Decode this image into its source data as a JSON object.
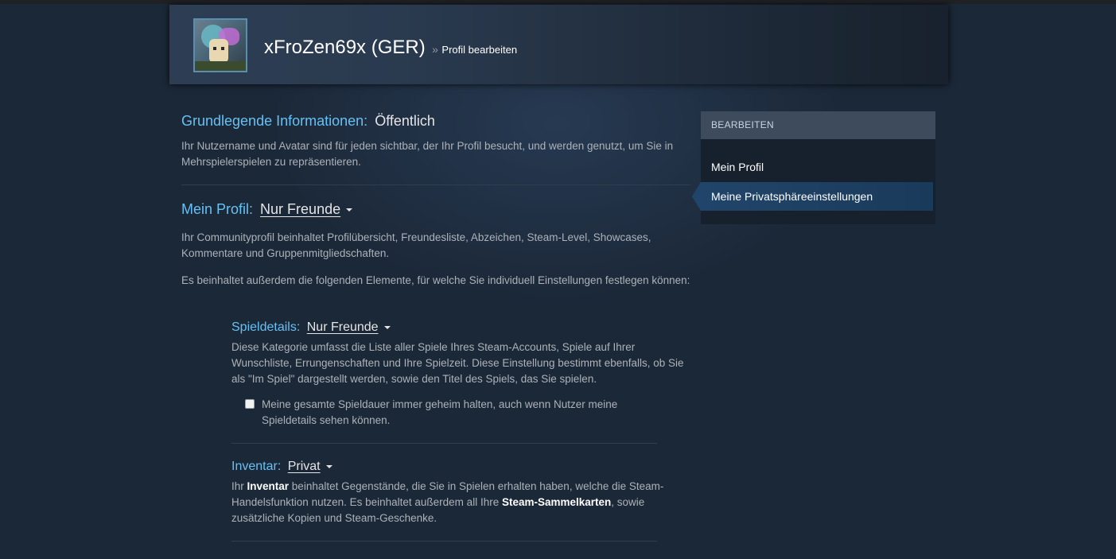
{
  "header": {
    "persona_name": "xFroZen69x (GER)",
    "separator": "»",
    "subpage": "Profil bearbeiten"
  },
  "basic_info": {
    "title": "Grundlegende Informationen:",
    "value": "Öffentlich",
    "description": "Ihr Nutzername und Avatar sind für jeden sichtbar, der Ihr Profil besucht, und werden genutzt, um Sie in Mehrspielerspielen zu repräsentieren."
  },
  "my_profile": {
    "title": "Mein Profil:",
    "setting": "Nur Freunde",
    "description": "Ihr Communityprofil beinhaltet Profilübersicht, Freundesliste, Abzeichen, Steam-Level, Showcases, Kommentare und Gruppenmitgliedschaften.",
    "description2": "Es beinhaltet außerdem die folgenden Elemente, für welche Sie individuell Einstellungen festlegen können:"
  },
  "game_details": {
    "title": "Spieldetails:",
    "setting": "Nur Freunde",
    "description": "Diese Kategorie umfasst die Liste aller Spiele Ihres Steam-Accounts, Spiele auf Ihrer Wunschliste, Errungenschaften und Ihre Spielzeit. Diese Einstellung bestimmt ebenfalls, ob Sie als \"Im Spiel\" dargestellt werden, sowie den Titel des Spiels, das Sie spielen.",
    "checkbox_label": "Meine gesamte Spieldauer immer geheim halten, auch wenn Nutzer meine Spieldetails sehen können.",
    "checkbox_checked": false
  },
  "inventory": {
    "title": "Inventar:",
    "setting": "Privat",
    "desc_part1": "Ihr ",
    "desc_bold1": "Inventar",
    "desc_part2": " beinhaltet Gegenstände, die Sie in Spielen erhalten haben, welche die Steam-Handelsfunktion nutzen. Es beinhaltet außerdem all Ihre ",
    "desc_bold2": "Steam-Sammelkarten",
    "desc_part3": ", sowie zusätzliche Kopien und Steam-Geschenke."
  },
  "sidebar": {
    "heading": "BEARBEITEN",
    "items": [
      {
        "label": "Mein Profil",
        "active": false
      },
      {
        "label": "Meine Privatsphäreeinstellungen",
        "active": true
      }
    ]
  },
  "colors": {
    "background": "#1b2838",
    "accent_blue": "#66c0f4",
    "active_item": "#21456a",
    "sidebar_head": "#3d4b5c"
  }
}
